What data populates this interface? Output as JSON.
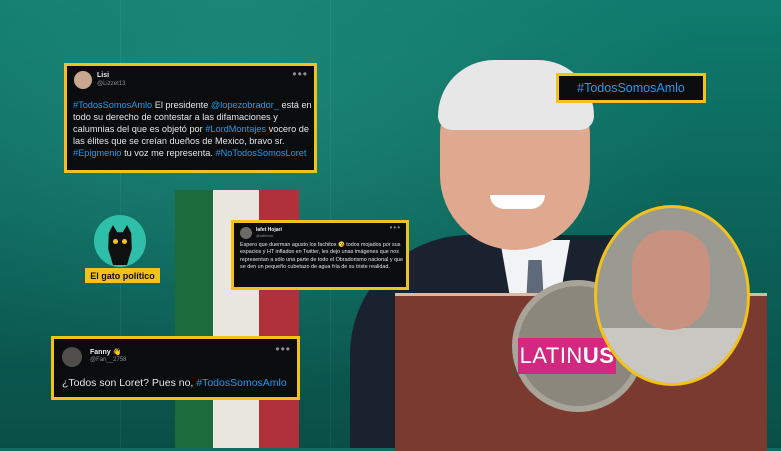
{
  "tweets": [
    {
      "name": "Lisi",
      "handle": "@Lizzet13",
      "body": [
        {
          "text": "#TodosSomosAmlo",
          "link": true
        },
        {
          "text": "  El presidente ",
          "link": false
        },
        {
          "text": "@lopezobrador_",
          "link": true
        },
        {
          "text": " está en todo su derecho de contestar a las difamaciones y calumnias del que es objetó por ",
          "link": false
        },
        {
          "text": "#LordMontajes",
          "link": true
        },
        {
          "text": " vocero de las élites que se creían dueños de Mexico, bravo sr. ",
          "link": false
        },
        {
          "text": "#Epigmenio",
          "link": true
        },
        {
          "text": " tu voz me representa. ",
          "link": false
        },
        {
          "text": "#NoTodosSomosLoret",
          "link": true
        }
      ]
    },
    {
      "name": "Iafet Hojari",
      "handle": "@iafetoro",
      "body": [
        {
          "text": "Espero que duerman agusto los fachitos 😘 todos mojados por sus espacios y HT inflados en Twitter, les dejo unas imágenes que nos representan a sólo una parte de todo el Obradorismo nacional y que se den un pequeño cubetazo de agua fría de su triste realidad.",
          "link": false
        }
      ]
    },
    {
      "name": "Fanny 👋",
      "handle": "@Fan__2758",
      "body": [
        {
          "text": "¿Todos son Loret? Pues no, ",
          "link": false
        },
        {
          "text": "#TodosSomosAmlo",
          "link": true
        }
      ]
    }
  ],
  "hashtag_label": "#TodosSomosAmlo",
  "logo_label": "El gato político",
  "broadcaster": {
    "text_regular": "LATIN",
    "text_bold": "US"
  },
  "colors": {
    "highlight_border": "#f3c21a",
    "link": "#1d9bf0",
    "tweet_bg": "#0b0c0e",
    "broadcaster_bg": "#d3287f"
  }
}
